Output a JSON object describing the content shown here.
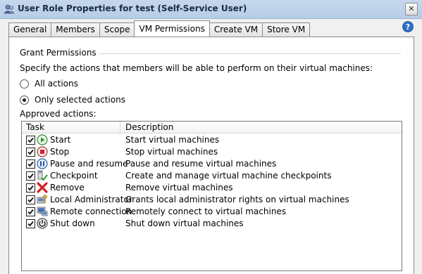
{
  "window": {
    "title": "User Role Properties for test (Self-Service User)",
    "close_glyph": "✕"
  },
  "tabs": [
    {
      "label": "General",
      "active": false
    },
    {
      "label": "Members",
      "active": false
    },
    {
      "label": "Scope",
      "active": false
    },
    {
      "label": "VM Permissions",
      "active": true
    },
    {
      "label": "Create VM",
      "active": false
    },
    {
      "label": "Store VM",
      "active": false
    }
  ],
  "permissions": {
    "group_title": "Grant Permissions",
    "instruction": "Specify the actions that members will be able to perform on their virtual machines:",
    "options": [
      {
        "label": "All actions",
        "selected": false
      },
      {
        "label": "Only selected actions",
        "selected": true
      }
    ],
    "approved_label": "Approved actions:",
    "columns": {
      "task": "Task",
      "description": "Description"
    },
    "actions": [
      {
        "task": "Start",
        "description": "Start virtual machines",
        "checked": true,
        "icon": "start-icon"
      },
      {
        "task": "Stop",
        "description": "Stop virtual machines",
        "checked": true,
        "icon": "stop-icon"
      },
      {
        "task": "Pause and resume",
        "description": "Pause and resume virtual machines",
        "checked": true,
        "icon": "pause-icon"
      },
      {
        "task": "Checkpoint",
        "description": "Create and manage virtual machine checkpoints",
        "checked": true,
        "icon": "checkpoint-icon"
      },
      {
        "task": "Remove",
        "description": "Remove virtual machines",
        "checked": true,
        "icon": "remove-icon"
      },
      {
        "task": "Local Administrator",
        "description": "Grants local administrator rights on virtual machines",
        "checked": true,
        "icon": "local-admin-icon"
      },
      {
        "task": "Remote connection",
        "description": "Remotely connect to virtual machines",
        "checked": true,
        "icon": "remote-connection-icon"
      },
      {
        "task": "Shut down",
        "description": "Shut down virtual machines",
        "checked": true,
        "icon": "shutdown-icon"
      }
    ]
  }
}
